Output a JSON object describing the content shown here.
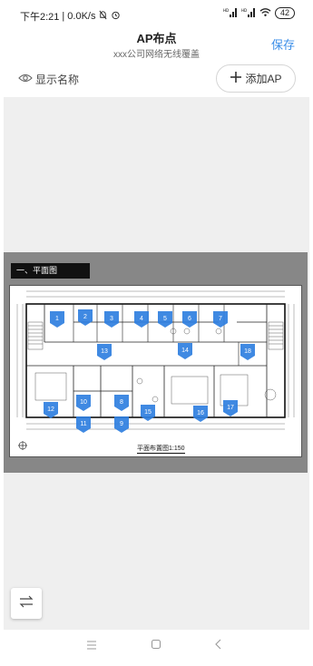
{
  "status_bar": {
    "time": "下午2:21",
    "network_speed": "0.0K/s",
    "battery": "42"
  },
  "header": {
    "title": "AP布点",
    "subtitle": "xxx公司网络无线覆盖",
    "save_label": "保存"
  },
  "toolbar": {
    "show_names_label": "显示名称",
    "add_ap_label": "添加AP"
  },
  "floor_plan": {
    "section_label": "一、平面图",
    "caption": "平面布置图1:150",
    "ap_markers": [
      "1",
      "2",
      "3",
      "4",
      "5",
      "6",
      "7",
      "8",
      "9",
      "10",
      "11",
      "12",
      "13",
      "14",
      "15",
      "16",
      "17",
      "18"
    ]
  },
  "colors": {
    "accent": "#3b8ee8",
    "marker": "#2f7fe0",
    "plan_background": "#878787",
    "canvas_background": "#efefef"
  },
  "icons": {
    "show_names": "eye-icon",
    "add_ap": "plus-icon",
    "switch": "swap-arrows-icon",
    "nav_menu": "menu-icon",
    "nav_home": "square-icon",
    "nav_back": "back-icon"
  }
}
